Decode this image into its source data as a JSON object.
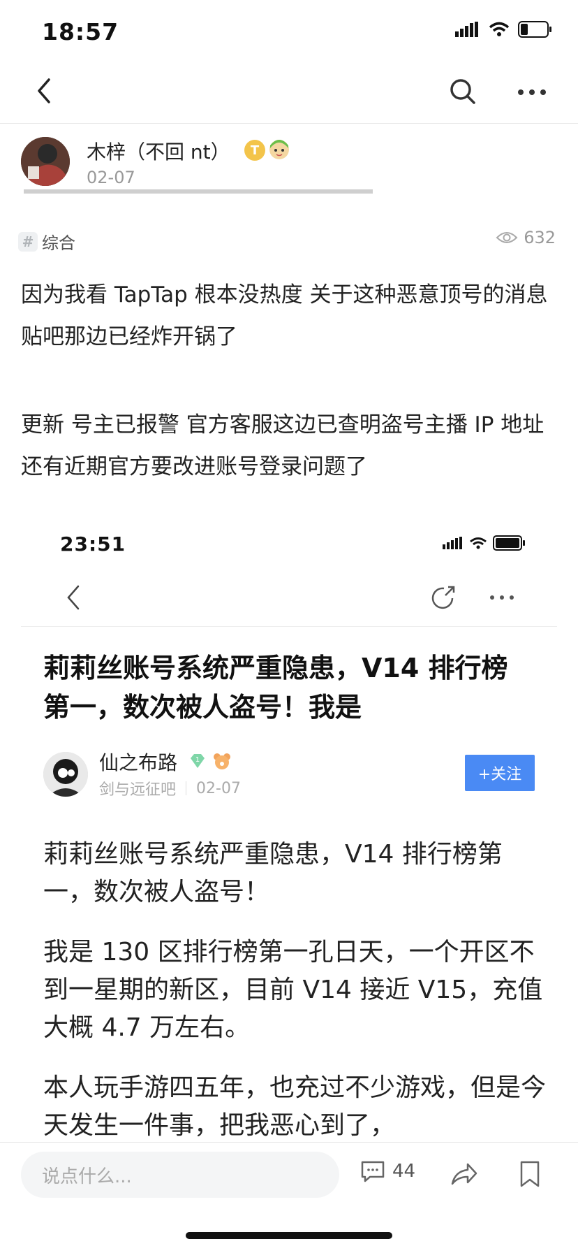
{
  "status_bar": {
    "time": "18:57"
  },
  "nav": {
    "back_icon": "chevron-left-icon",
    "search_icon": "search-icon",
    "more_icon": "more-horizontal-icon"
  },
  "post": {
    "author": "木梓（不回 nt）",
    "date": "02-07",
    "badge_letter": "T",
    "tag": "综合",
    "views": "632",
    "paragraphs": [
      "因为我看 TapTap 根本没热度 关于这种恶意顶号的消息 贴吧那边已经炸开锅了",
      "更新 号主已报警 官方客服这边已查明盗号主播 IP 地址  还有近期官方要改进账号登录问题了"
    ]
  },
  "embedded": {
    "time": "23:51",
    "title": "莉莉丝账号系统严重隐患，V14 排行榜第一，数次被人盗号！我是",
    "author": "仙之布路",
    "forum": "剑与远征吧",
    "date": "02-07",
    "follow_label": "+关注",
    "paragraphs": [
      "莉莉丝账号系统严重隐患，V14 排行榜第一，数次被人盗号！",
      "我是 130 区排行榜第一孔日天，一个开区不到一星期的新区，目前 V14 接近 V15，充值大概 4.7 万左右。",
      "本人玩手游四五年，也充过不少游戏，但是今天发生一件事，把我恶心到了，"
    ]
  },
  "bottom_bar": {
    "placeholder": "说点什么...",
    "comment_count": "44"
  },
  "colors": {
    "accent": "#4a8af4",
    "muted": "#999999"
  }
}
